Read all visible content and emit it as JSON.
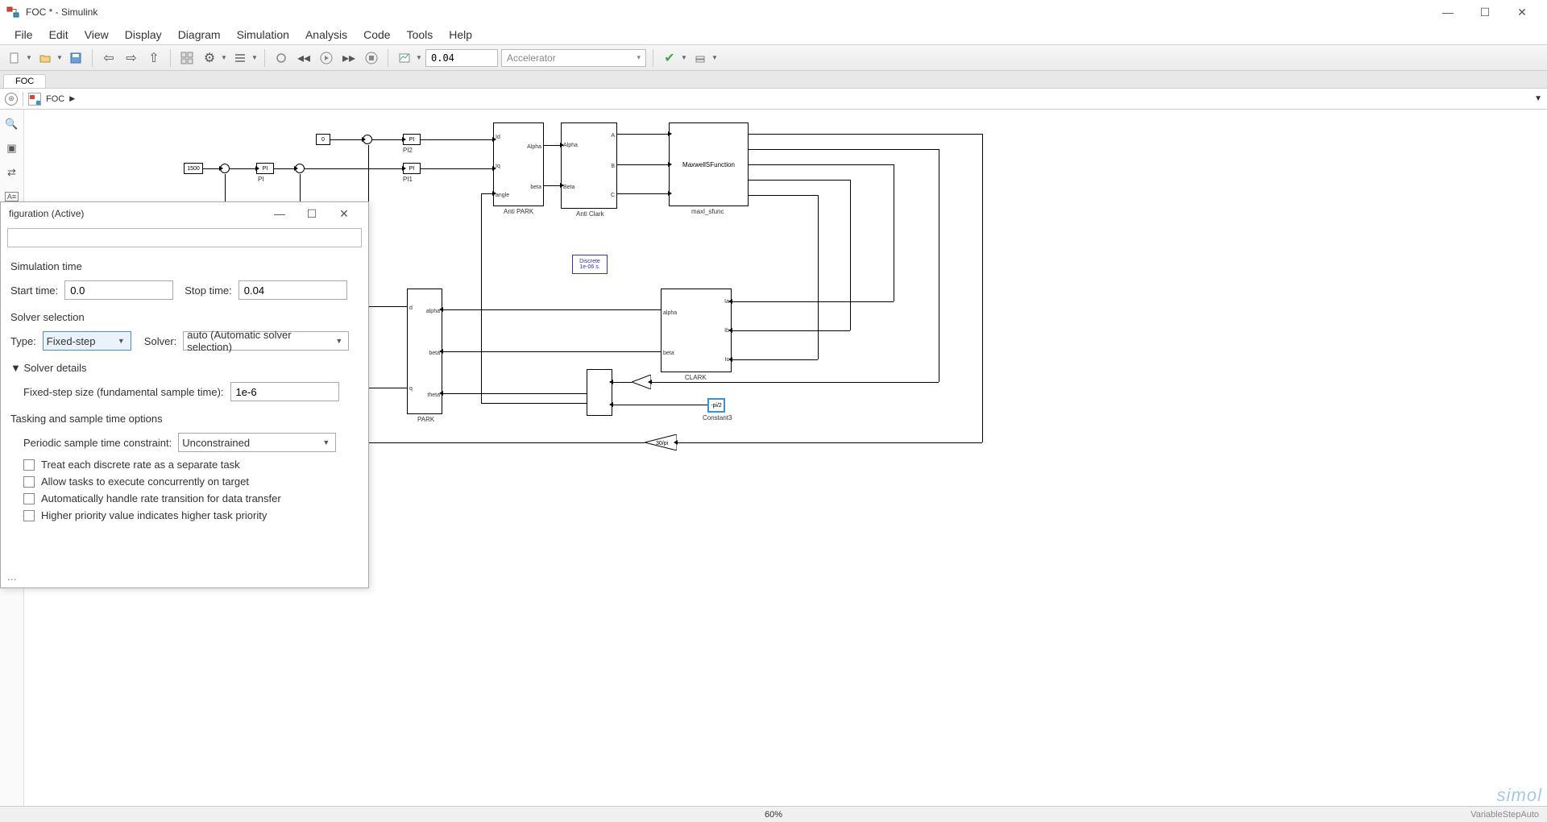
{
  "window": {
    "title": "FOC * - Simulink"
  },
  "menu": [
    "File",
    "Edit",
    "View",
    "Display",
    "Diagram",
    "Simulation",
    "Analysis",
    "Code",
    "Tools",
    "Help"
  ],
  "toolbar": {
    "stop_time": "0.04",
    "sim_mode": "Accelerator"
  },
  "tab": {
    "name": "FOC"
  },
  "breadcrumb": {
    "model": "FOC"
  },
  "status": {
    "zoom": "60%",
    "solver": "VariableStepAuto"
  },
  "blocks": {
    "const0": "0",
    "const1500": "1500",
    "pi_label": "PI",
    "pi_name": "PI",
    "pi1_name": "PI",
    "pi2_name": "PI2",
    "pi1_under": "PI1",
    "antipark": {
      "name": "Anti PARK",
      "in1": "Id",
      "in2": "Iq",
      "in3": "angle",
      "out1": "Alpha",
      "out2": "beta"
    },
    "anticlark": {
      "name": "Anti Clark",
      "in1": "Alpha",
      "in2": "Beta",
      "outA": "A",
      "outB": "B",
      "outC": "C"
    },
    "maxwell": {
      "name": "maxl_sfunc",
      "text": "MaxwellSFunction"
    },
    "clark": {
      "name": "CLARK",
      "in1": "Ia",
      "in2": "Ib",
      "in3": "Ic",
      "out1": "alpha",
      "out2": "beta"
    },
    "park": {
      "name": "PARK",
      "out_d": "d",
      "out_q": "q",
      "in_a": "alpha",
      "in_b": "beta",
      "in_t": "theta"
    },
    "discrete": {
      "l1": "Discrete",
      "l2": "1e-06 s."
    },
    "const_pi2": "-pi/2",
    "const_pi2_name": "Constant3",
    "gain30pi": "30/pi"
  },
  "dialog": {
    "title": "figuration (Active)",
    "sim_time": "Simulation time",
    "start_label": "Start time:",
    "start_val": "0.0",
    "stop_label": "Stop time:",
    "stop_val": "0.04",
    "solver_sel": "Solver selection",
    "type_label": "Type:",
    "type_val": "Fixed-step",
    "solver_label": "Solver:",
    "solver_val": "auto (Automatic solver selection)",
    "details": "Solver details",
    "fixed_step_label": "Fixed-step size (fundamental sample time):",
    "fixed_step_val": "1e-6",
    "tasking": "Tasking and sample time options",
    "periodic_label": "Periodic sample time constraint:",
    "periodic_val": "Unconstrained",
    "chk1": "Treat each discrete rate as a separate task",
    "chk2": "Allow tasks to execute concurrently on target",
    "chk3": "Automatically handle rate transition for data transfer",
    "chk4": "Higher priority value indicates higher task priority"
  },
  "watermark": "simol"
}
